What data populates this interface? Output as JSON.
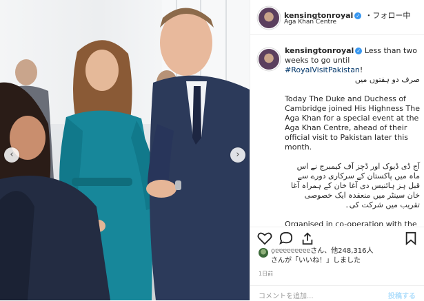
{
  "post": {
    "username": "kensingtonroyal",
    "follow_label": "・フォロー中",
    "location": "Aga Khan Centre",
    "verified_badge": "✓"
  },
  "caption": {
    "line_first": "Less than two weeks to go until",
    "hashtag": "#RoyalVisitPakistan",
    "hashtag_suffix": "!",
    "urdu_1": "صرف دو ہفتوں میں",
    "english_1": "Today The Duke and Duchess of Cambridge joined His Highness The Aga Khan for a special event at the Aga Khan Centre, ahead of their official visit to Pakistan later this month.",
    "urdu_2": "آج ڈی ڈیوک اور ڈچز آف کیمبرج نے اس ماہ میں پاکستان کے سرکاری دورے سے قبل ہز ہائنیس دی آغا خان کے ہمراہ آغا خان سینٹر میں منعقدہ ایک خصوصی تقریب میں شرکت کی۔",
    "english_2": "Organised in co-operation with the High Commission of Pakistan, today's"
  },
  "likes": {
    "liker_name": "ǫɐɐɐɐɐɐɐɐɐ",
    "line1_suffix": "さん、他248,316人",
    "line2": "さんが「いいね！」しました"
  },
  "time_label": "1日前",
  "comment": {
    "placeholder": "コメントを追加...",
    "post_label": "投稿する"
  },
  "nav": {
    "prev_arrow": "‹",
    "next_arrow": "›"
  },
  "colors": {
    "link": "#003569",
    "verified": "#3897f0",
    "border": "#efefef"
  },
  "icons": [
    "heart-icon",
    "comment-icon",
    "share-icon",
    "bookmark-icon",
    "verified-icon"
  ]
}
